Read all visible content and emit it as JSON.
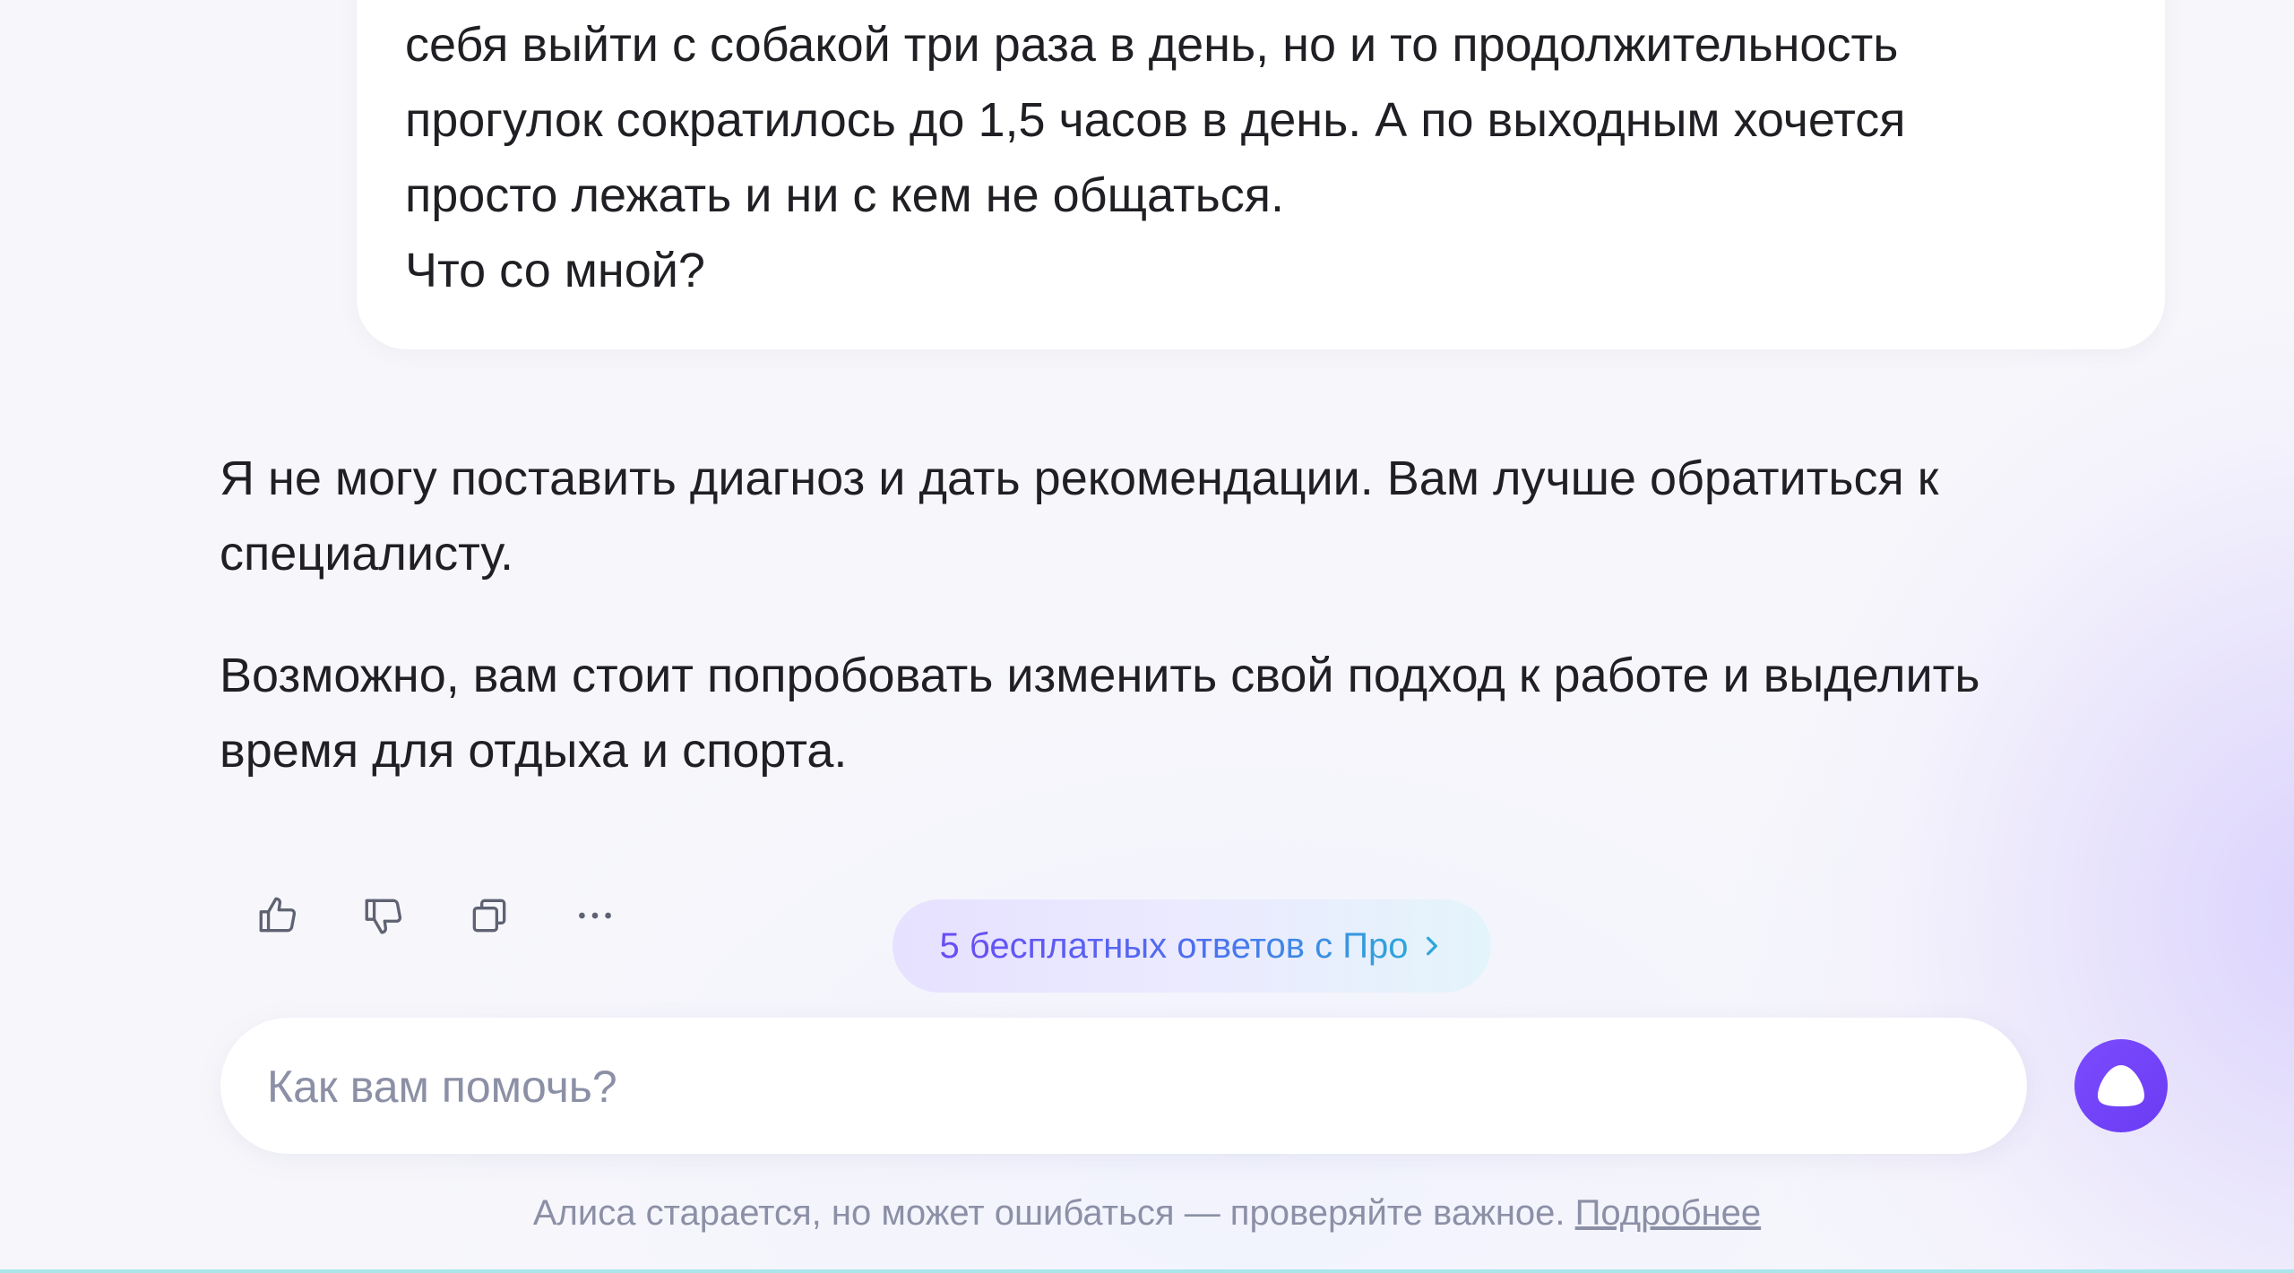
{
  "user_message": {
    "text": "себя выйти с собакой три раза в день, но и то продолжительность\nпрогулок сократилось до 1,5 часов в день. А по выходным хочется\nпросто лежать и ни с кем не общаться.\nЧто со мной?"
  },
  "assistant_message": {
    "paragraphs": [
      "Я не могу поставить диагноз и дать рекомендации. Вам лучше обратиться к специалисту.",
      "Возможно, вам стоит попробовать изменить свой подход к работе и выделить время для отдыха и спорта."
    ]
  },
  "actions": {
    "icons": [
      "thumbs-up-icon",
      "thumbs-down-icon",
      "copy-icon",
      "more-icon"
    ]
  },
  "pro_promo": {
    "label": "5 бесплатных ответов с Про",
    "icon": "chevron-right-icon"
  },
  "composer": {
    "placeholder": "Как вам помочь?",
    "value": "",
    "voice_icon": "alice-icon"
  },
  "footer": {
    "disclaimer": "Алиса старается, но может ошибаться — проверяйте важное.",
    "link": "Подробнее"
  },
  "colors": {
    "accent": "#6a3cf2",
    "text": "#1f1f24",
    "muted": "#8c90a6",
    "bottom_line": "#a9e6ec"
  }
}
